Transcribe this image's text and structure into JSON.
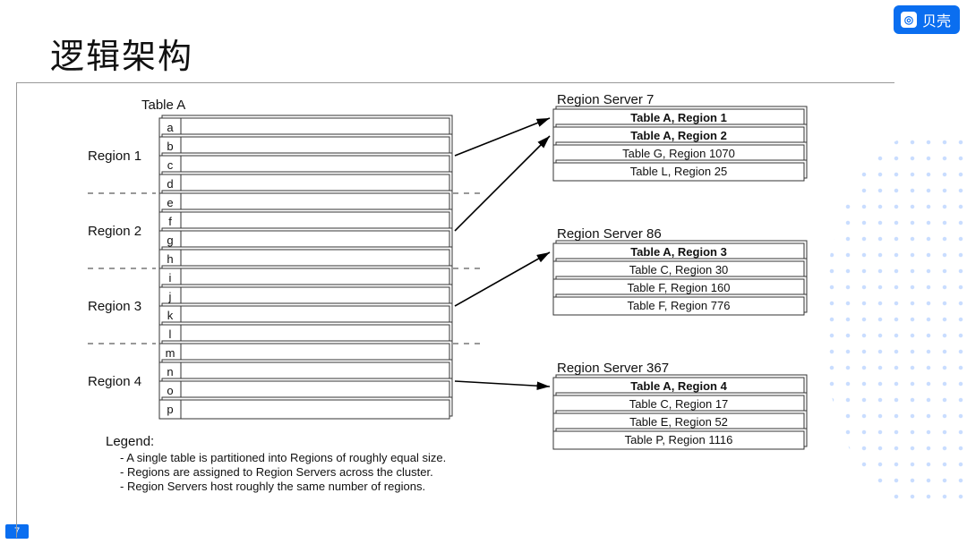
{
  "brand": {
    "label": "贝壳"
  },
  "title": "逻辑架构",
  "page": "7",
  "table": {
    "label": "Table A",
    "regions": [
      {
        "name": "Region 1",
        "rows": [
          "a",
          "b",
          "c",
          "d"
        ]
      },
      {
        "name": "Region 2",
        "rows": [
          "e",
          "f",
          "g",
          "h"
        ]
      },
      {
        "name": "Region 3",
        "rows": [
          "i",
          "j",
          "k",
          "l"
        ]
      },
      {
        "name": "Region 4",
        "rows": [
          "m",
          "n",
          "o",
          "p"
        ]
      }
    ]
  },
  "servers": [
    {
      "title": "Region Server 7",
      "items": [
        {
          "label": "Table A, Region 1",
          "bold": true
        },
        {
          "label": "Table A, Region 2",
          "bold": true
        },
        {
          "label": "Table G, Region 1070",
          "bold": false
        },
        {
          "label": "Table L, Region 25",
          "bold": false
        }
      ]
    },
    {
      "title": "Region Server 86",
      "items": [
        {
          "label": "Table A, Region 3",
          "bold": true
        },
        {
          "label": "Table C, Region 30",
          "bold": false
        },
        {
          "label": "Table F, Region 160",
          "bold": false
        },
        {
          "label": "Table F, Region 776",
          "bold": false
        }
      ]
    },
    {
      "title": "Region Server 367",
      "items": [
        {
          "label": "Table A, Region 4",
          "bold": true
        },
        {
          "label": "Table C, Region 17",
          "bold": false
        },
        {
          "label": "Table E, Region 52",
          "bold": false
        },
        {
          "label": "Table P, Region 1116",
          "bold": false
        }
      ]
    }
  ],
  "legend": {
    "title": "Legend:",
    "lines": [
      "- A single table is partitioned into Regions of roughly equal size.",
      "- Regions are assigned to Region Servers across the cluster.",
      "- Region Servers host roughly the same number of regions."
    ]
  }
}
